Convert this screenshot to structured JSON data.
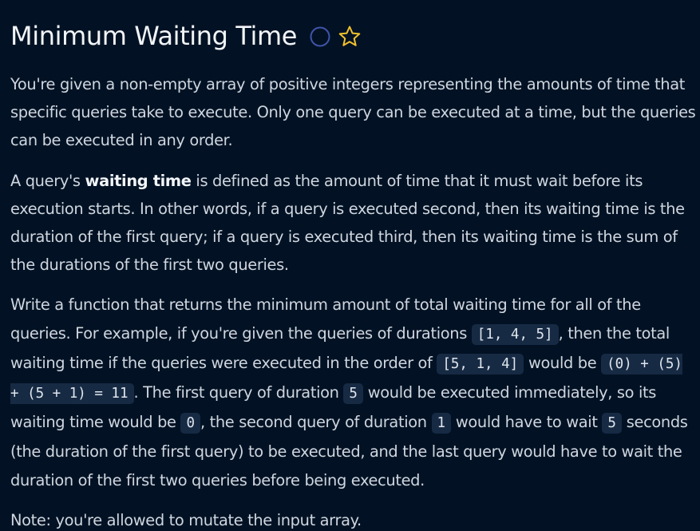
{
  "title": "Minimum Waiting Time",
  "colors": {
    "background": "#021224",
    "text": "#cfd6df",
    "title": "#f2f5f8",
    "status_icon": "#3f54a8",
    "star_icon": "#f2c12e",
    "code_bg": "#172a44"
  },
  "icons": {
    "status": "circle-icon",
    "favorite": "star-icon"
  },
  "p1": "You're given a non-empty array of positive integers representing the amounts of time that specific queries take to execute. Only one query can be executed at a time, but the queries can be executed in any order.",
  "p2": {
    "a": "A query's ",
    "b": "waiting time",
    "c": " is defined as the amount of time that it must wait before its execution starts. In other words, if a query is executed second, then its waiting time is the duration of the first query; if a query is executed third, then its waiting time is the sum of the durations of the first two queries."
  },
  "p3": {
    "t1": "Write a function that returns the minimum amount of total waiting time for all of the queries. For example, if you're given the queries of durations ",
    "c1": "[1, 4, 5]",
    "t2": ", then the total waiting time if the queries were executed in the order of ",
    "c2": "[5, 1, 4]",
    "t3": " would be ",
    "c3": "(0) + (5) + (5 + 1) = 11",
    "t4": ". The first query of duration ",
    "c4": "5",
    "t5": " would be executed immediately, so its waiting time would be ",
    "c5": "0",
    "t6": ", the second query of duration ",
    "c6": "1",
    "t7": " would have to wait ",
    "c7": "5",
    "t8": " seconds (the duration of the first query) to be executed, and the last query would have to wait the duration of the first two queries before being executed."
  },
  "p4": "Note: you're allowed to mutate the input array."
}
